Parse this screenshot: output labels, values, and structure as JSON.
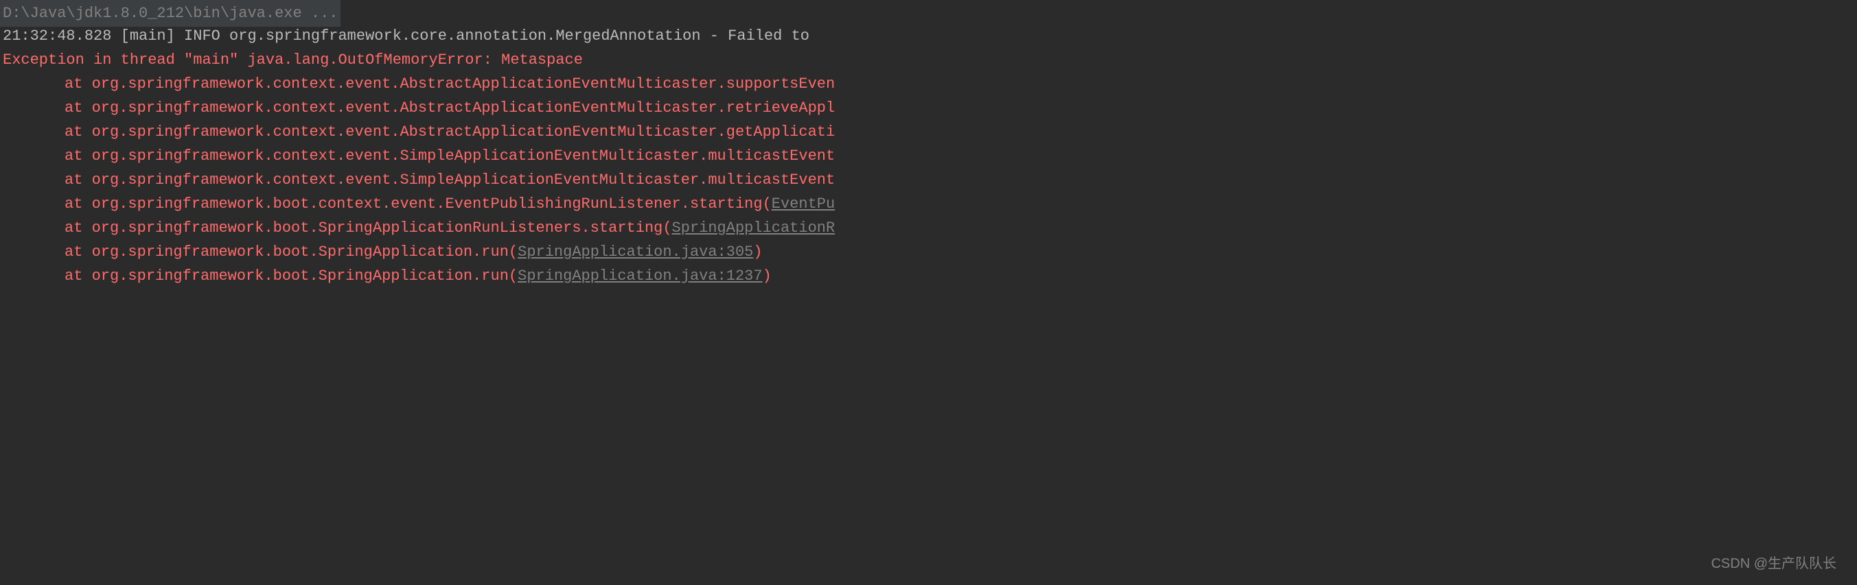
{
  "console": {
    "command": "D:\\Java\\jdk1.8.0_212\\bin\\java.exe ...",
    "log_line": "21:32:48.828 [main] INFO org.springframework.core.annotation.MergedAnnotation - Failed to",
    "exception": "Exception in thread \"main\" java.lang.OutOfMemoryError: Metaspace",
    "stacktrace": [
      {
        "prefix": "at ",
        "method": "org.springframework.context.event.AbstractApplicationEventMulticaster.supportsEven"
      },
      {
        "prefix": "at ",
        "method": "org.springframework.context.event.AbstractApplicationEventMulticaster.retrieveAppl"
      },
      {
        "prefix": "at ",
        "method": "org.springframework.context.event.AbstractApplicationEventMulticaster.getApplicati"
      },
      {
        "prefix": "at ",
        "method": "org.springframework.context.event.SimpleApplicationEventMulticaster.multicastEvent"
      },
      {
        "prefix": "at ",
        "method": "org.springframework.context.event.SimpleApplicationEventMulticaster.multicastEvent"
      },
      {
        "prefix": "at ",
        "method": "org.springframework.boot.context.event.EventPublishingRunListener.starting(",
        "link": "EventPu"
      },
      {
        "prefix": "at ",
        "method": "org.springframework.boot.SpringApplicationRunListeners.starting(",
        "link": "SpringApplicationR"
      },
      {
        "prefix": "at ",
        "method": "org.springframework.boot.SpringApplication.run(",
        "link": "SpringApplication.java:305",
        "suffix": ")"
      },
      {
        "prefix": "at ",
        "method": "org.springframework.boot.SpringApplication.run(",
        "link": "SpringApplication.java:1237",
        "suffix": ")"
      }
    ]
  },
  "watermark": "CSDN @生产队队长"
}
